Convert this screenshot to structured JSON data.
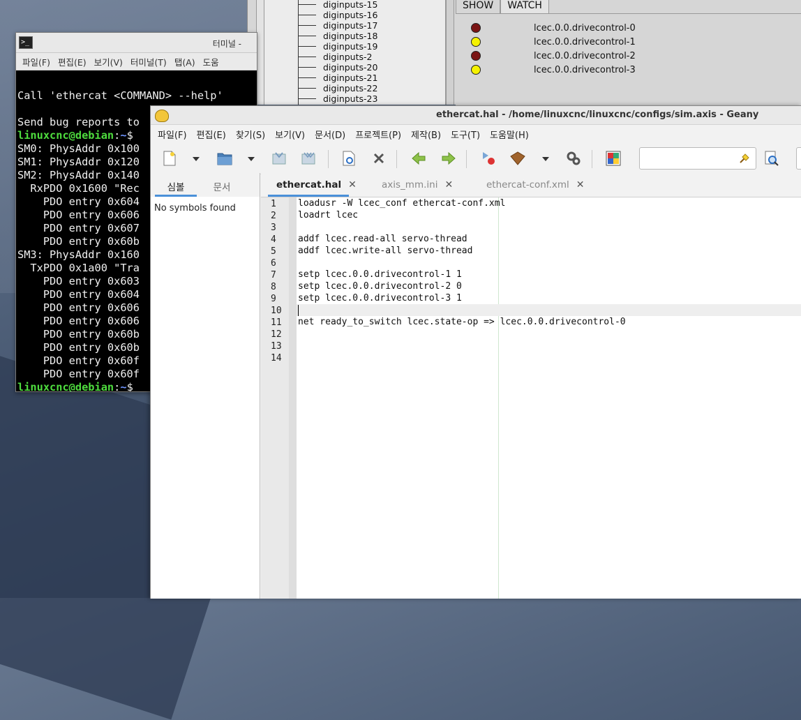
{
  "hal_show": {
    "tree_items": [
      "diginputs-15",
      "diginputs-16",
      "diginputs-17",
      "diginputs-18",
      "diginputs-19",
      "diginputs-2",
      "diginputs-20",
      "diginputs-21",
      "diginputs-22",
      "diginputs-23"
    ],
    "tabs": [
      "SHOW",
      "WATCH"
    ],
    "watch": [
      {
        "name": "lcec.0.0.drivecontrol-0",
        "color": "#7a1414"
      },
      {
        "name": "lcec.0.0.drivecontrol-1",
        "color": "#f5f200"
      },
      {
        "name": "lcec.0.0.drivecontrol-2",
        "color": "#7a1414"
      },
      {
        "name": "lcec.0.0.drivecontrol-3",
        "color": "#f5f200"
      }
    ]
  },
  "terminal": {
    "title": "터미널 -",
    "menu": [
      "파일(F)",
      "편집(E)",
      "보기(V)",
      "터미널(T)",
      "탭(A)",
      "도움"
    ],
    "lines": [
      {
        "text": ""
      },
      {
        "text": "Call 'ethercat <COMMAND> --help'"
      },
      {
        "text": ""
      },
      {
        "text": "Send bug reports to"
      },
      {
        "prompt_user": "linuxcnc@debian",
        "prompt_sep": ":",
        "prompt_path": "~",
        "prompt_end": "$"
      },
      {
        "text": "SM0: PhysAddr 0x100"
      },
      {
        "text": "SM1: PhysAddr 0x120"
      },
      {
        "text": "SM2: PhysAddr 0x140"
      },
      {
        "text": "  RxPDO 0x1600 \"Rec"
      },
      {
        "text": "    PDO entry 0x604"
      },
      {
        "text": "    PDO entry 0x606"
      },
      {
        "text": "    PDO entry 0x607"
      },
      {
        "text": "    PDO entry 0x60b"
      },
      {
        "text": "SM3: PhysAddr 0x160"
      },
      {
        "text": "  TxPDO 0x1a00 \"Tra"
      },
      {
        "text": "    PDO entry 0x603"
      },
      {
        "text": "    PDO entry 0x604"
      },
      {
        "text": "    PDO entry 0x606"
      },
      {
        "text": "    PDO entry 0x606"
      },
      {
        "text": "    PDO entry 0x60b"
      },
      {
        "text": "    PDO entry 0x60b"
      },
      {
        "text": "    PDO entry 0x60f"
      },
      {
        "text": "    PDO entry 0x60f"
      },
      {
        "prompt_user": "linuxcnc@debian",
        "prompt_sep": ":",
        "prompt_path": "~",
        "prompt_end": "$"
      }
    ]
  },
  "geany": {
    "title": "ethercat.hal - /home/linuxcnc/linuxcnc/configs/sim.axis - Geany",
    "menu": [
      "파일(F)",
      "편집(E)",
      "찾기(S)",
      "보기(V)",
      "문서(D)",
      "프로젝트(P)",
      "제작(B)",
      "도구(T)",
      "도움말(H)"
    ],
    "sidebar_tabs": [
      "심볼",
      "문서"
    ],
    "sidebar_message": "No symbols found",
    "editor_tabs": [
      "ethercat.hal",
      "axis_mm.ini",
      "ethercat-conf.xml"
    ],
    "code_lines": [
      "loadusr -W lcec_conf ethercat-conf.xml",
      "loadrt lcec",
      "",
      "addf lcec.read-all servo-thread",
      "addf lcec.write-all servo-thread",
      "",
      "setp lcec.0.0.drivecontrol-1 1",
      "setp lcec.0.0.drivecontrol-2 0",
      "setp lcec.0.0.drivecontrol-3 1",
      "",
      "net ready_to_switch lcec.state-op => lcec.0.0.drivecontrol-0",
      "",
      "",
      ""
    ],
    "line_numbers": [
      "1",
      "2",
      "3",
      "4",
      "5",
      "6",
      "7",
      "8",
      "9",
      "10",
      "11",
      "12",
      "13",
      "14"
    ],
    "current_line": 10
  }
}
